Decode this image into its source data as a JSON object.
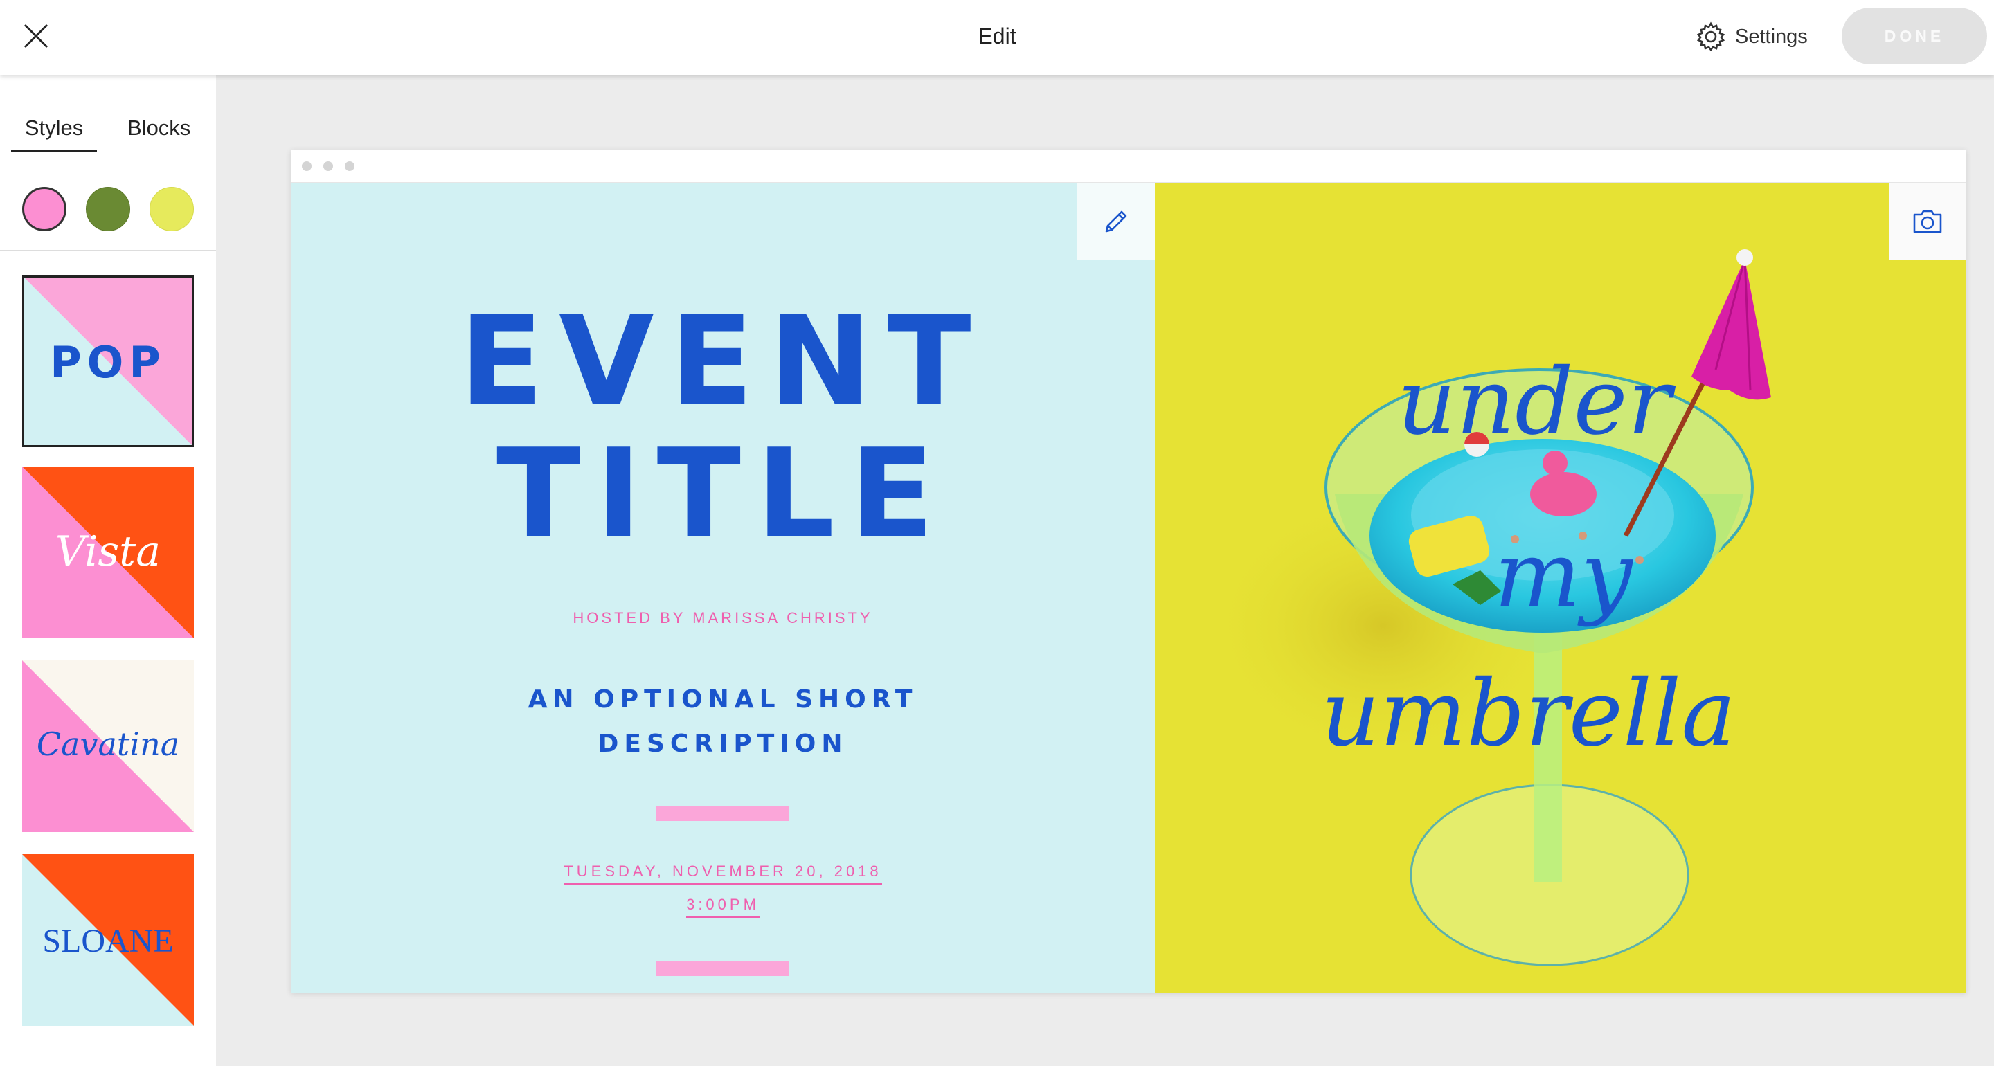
{
  "header": {
    "title": "Edit",
    "settings_label": "Settings",
    "done_label": "DONE",
    "close_icon": "close-icon",
    "settings_icon": "gear-icon"
  },
  "sidebar": {
    "tabs": [
      {
        "label": "Styles",
        "active": true
      },
      {
        "label": "Blocks",
        "active": false
      }
    ],
    "swatches": [
      {
        "color": "#fc8fd2",
        "selected": true
      },
      {
        "color": "#6a8a33",
        "selected": false
      },
      {
        "color": "#e6ea5c",
        "selected": false
      }
    ],
    "styles": [
      {
        "label": "POP",
        "selected": true
      },
      {
        "label": "Vista",
        "selected": false
      },
      {
        "label": "Cavatina",
        "selected": false
      },
      {
        "label": "SLOANE",
        "selected": false
      }
    ]
  },
  "canvas": {
    "event_title_line1": "EVENT",
    "event_title_line2": "TITLE",
    "hosted_by": "HOSTED BY MARISSA CHRISTY",
    "description_line1": "AN OPTIONAL SHORT",
    "description_line2": "DESCRIPTION",
    "date": "TUESDAY, NOVEMBER 20, 2018",
    "time": "3:00PM",
    "image_script_line1": "under",
    "image_script_line2": "my",
    "image_script_line3": "umbrella",
    "edit_icon": "pencil-icon",
    "photo_icon": "camera-icon"
  },
  "colors": {
    "accent_blue": "#1a55cc",
    "accent_pink": "#ef5fae",
    "panel_bg": "#d2f1f3",
    "image_bg": "#e6e234",
    "orange": "#ff5214"
  }
}
